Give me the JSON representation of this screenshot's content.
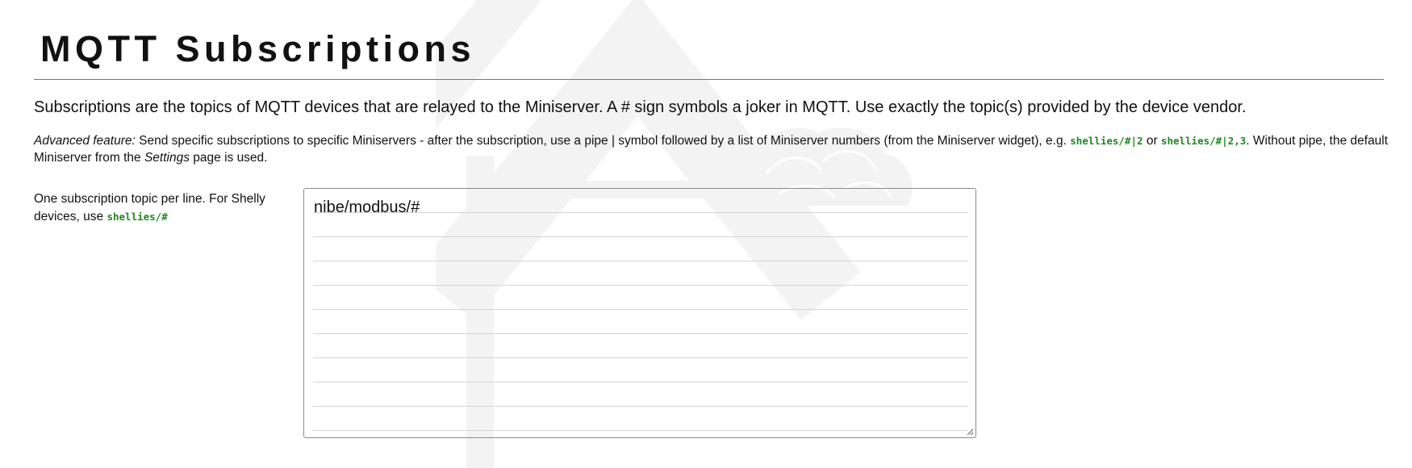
{
  "header": {
    "title": "MQTT Subscriptions"
  },
  "intro": {
    "text": "Subscriptions are the topics of MQTT devices that are relayed to the Miniserver. A # sign symbols a joker in MQTT. Use exactly the topic(s) provided by the device vendor."
  },
  "advanced": {
    "label": "Advanced feature:",
    "text_1": " Send specific subscriptions to specific Miniservers - after the subscription, use a pipe | symbol followed by a list of Miniserver numbers (from the Miniserver widget), e.g. ",
    "example_1": "shellies/#|2",
    "text_2": " or ",
    "example_2": "shellies/#|2,3",
    "text_3": ". Without pipe, the default Miniserver from the ",
    "settings_word": "Settings",
    "text_4": " page is used."
  },
  "subscriptions": {
    "label": "One subscription topic per line. For Shelly devices, use ",
    "label_code": "shellies/#",
    "value": "nibe/modbus/#"
  },
  "icons": {
    "watermark": "house-logo-watermark",
    "resize": "resize-grip-icon"
  },
  "colors": {
    "code_green": "#1e8a1e",
    "rule_gray": "#777777",
    "watermark_gray": "#f2f2f2"
  }
}
